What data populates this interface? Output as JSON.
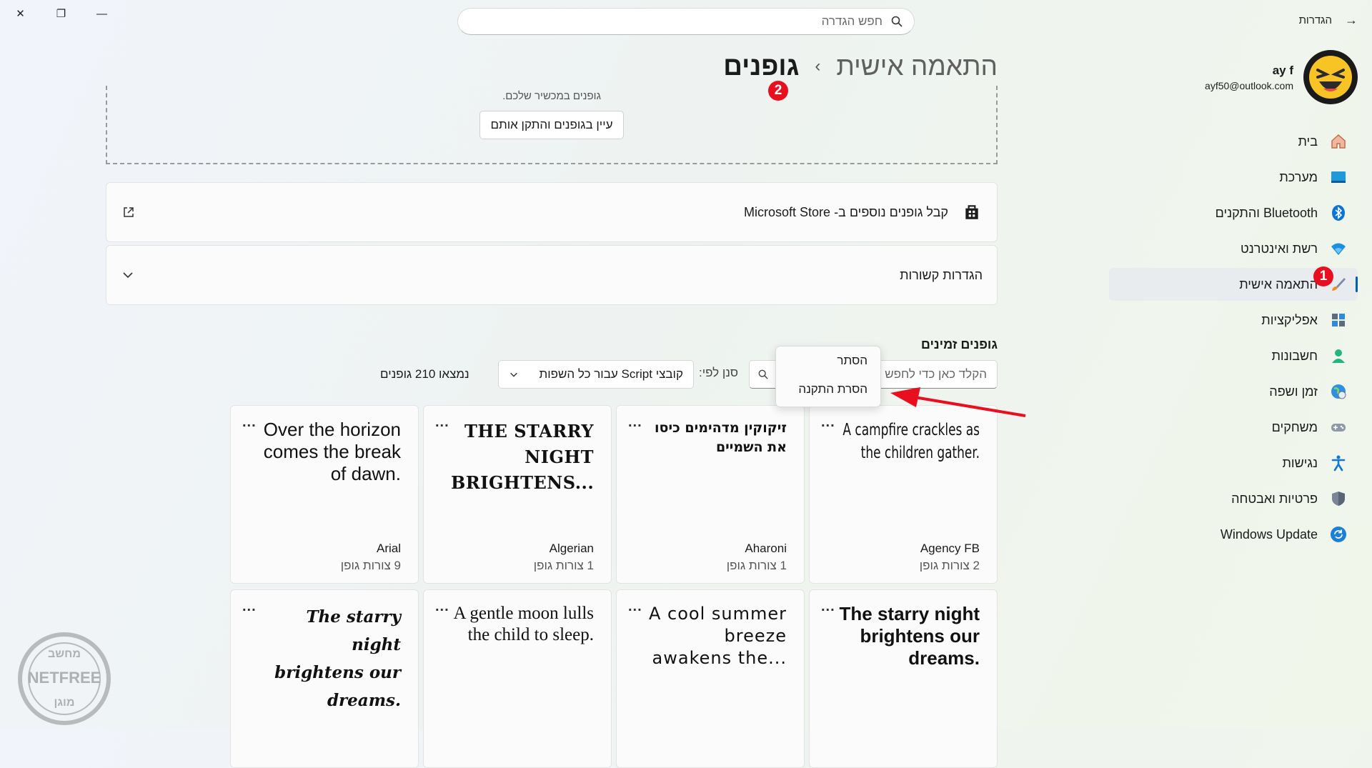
{
  "window": {
    "close": "✕",
    "restore": "❐",
    "minimize": "—"
  },
  "header": {
    "app_title": "הגדרות",
    "search_placeholder": "חפש הגדרה"
  },
  "user": {
    "name": "ay f",
    "email": "ayf50@outlook.com"
  },
  "sidebar": {
    "items": [
      {
        "label": "בית",
        "icon": "home-icon"
      },
      {
        "label": "מערכת",
        "icon": "system-icon"
      },
      {
        "label": "Bluetooth והתקנים",
        "icon": "bluetooth-icon"
      },
      {
        "label": "רשת ואינטרנט",
        "icon": "wifi-icon"
      },
      {
        "label": "התאמה אישית",
        "icon": "brush-icon"
      },
      {
        "label": "אפליקציות",
        "icon": "apps-icon"
      },
      {
        "label": "חשבונות",
        "icon": "person-icon"
      },
      {
        "label": "זמן ושפה",
        "icon": "globe-clock-icon"
      },
      {
        "label": "משחקים",
        "icon": "gamepad-icon"
      },
      {
        "label": "נגישות",
        "icon": "accessibility-icon"
      },
      {
        "label": "פרטיות ואבטחה",
        "icon": "shield-icon"
      },
      {
        "label": "Windows Update",
        "icon": "update-icon"
      }
    ],
    "active_index": 4
  },
  "annotations": {
    "badge1": "1",
    "badge2": "2"
  },
  "breadcrumb": {
    "parent": "התאמה אישית",
    "separator": "›",
    "current": "גופנים"
  },
  "drop_zone": {
    "text": "גופנים במכשיר שלכם.",
    "button": "עיין בגופנים והתקן אותם"
  },
  "store_row": {
    "label": "קבל גופנים נוספים ב- Microsoft Store"
  },
  "related_row": {
    "label": "הגדרות קשורות"
  },
  "available": {
    "title": "גופנים זמינים",
    "filter_placeholder": "הקלד כאן כדי לחפש",
    "filter_by_label": "סנן לפי:",
    "filter_value": "קובצי Script עבור כל השפות",
    "found": "נמצאו 210 גופנים"
  },
  "context_menu": {
    "items": [
      "הסתר",
      "הסרת התקנה"
    ]
  },
  "fonts": [
    {
      "sample": "A campfire crackles as the children gather.",
      "name": "Agency FB",
      "count": "2 צורות גופן"
    },
    {
      "sample": "זיקוקין מדהימים כיסו את השמיים",
      "name": "Aharoni",
      "count": "1 צורות גופן"
    },
    {
      "sample": "THE STARRY NIGHT BRIGHTENS...",
      "name": "Algerian",
      "count": "1 צורות גופן"
    },
    {
      "sample": "Over the horizon comes the break of dawn.",
      "name": "Arial",
      "count": "9 צורות גופן"
    },
    {
      "sample": "The starry night brightens our dreams.",
      "name": "",
      "count": ""
    },
    {
      "sample": "A cool summer breeze awakens the...",
      "name": "",
      "count": ""
    },
    {
      "sample": "A gentle moon lulls the child to sleep.",
      "name": "",
      "count": ""
    },
    {
      "sample": "The starry night brightens our dreams.",
      "name": "",
      "count": ""
    }
  ],
  "more_label": "...",
  "watermark": {
    "top": "מחשב",
    "middle": "NETFREE",
    "bottom": "מוגן"
  }
}
